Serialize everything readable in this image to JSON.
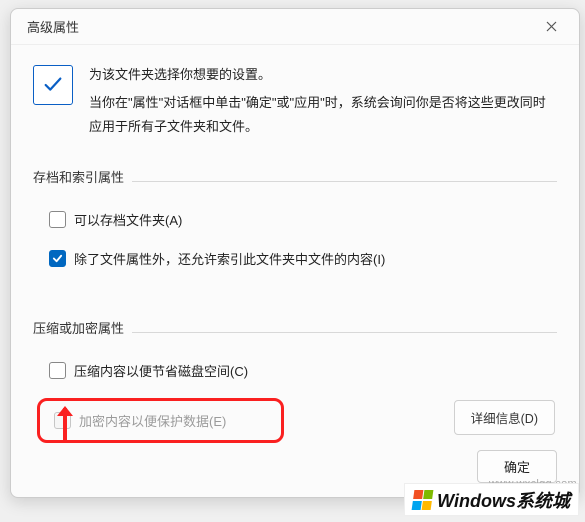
{
  "dialog": {
    "title": "高级属性",
    "header": {
      "line1": "为该文件夹选择你想要的设置。",
      "line2": "当你在\"属性\"对话框中单击\"确定\"或\"应用\"时，系统会询问你是否将这些更改同时应用于所有子文件夹和文件。"
    },
    "group1": {
      "label": "存档和索引属性",
      "archive": {
        "label": "可以存档文件夹(A)",
        "checked": false
      },
      "index": {
        "label": "除了文件属性外，还允许索引此文件夹中文件的内容(I)",
        "checked": true
      }
    },
    "group2": {
      "label": "压缩或加密属性",
      "compress": {
        "label": "压缩内容以便节省磁盘空间(C)",
        "checked": false
      },
      "encrypt": {
        "label": "加密内容以便保护数据(E)",
        "checked": false,
        "disabled": true
      }
    },
    "buttons": {
      "details": "详细信息(D)",
      "ok": "确定"
    }
  },
  "watermark": {
    "url": "www.wxclgg.com",
    "brand": "Windows系统城"
  },
  "colors": {
    "accent": "#0067c0",
    "highlight": "#fa2020"
  }
}
